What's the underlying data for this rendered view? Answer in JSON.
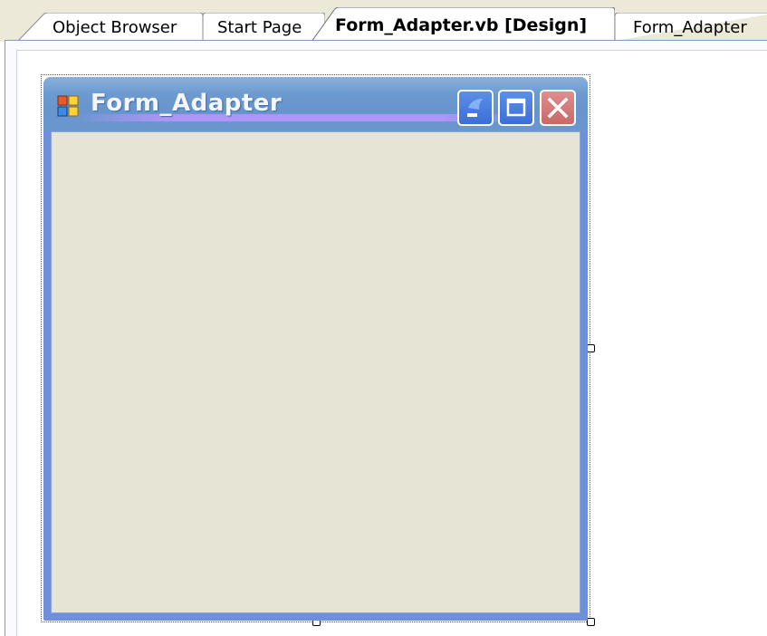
{
  "tabs": [
    {
      "label": "Object Browser",
      "active": false
    },
    {
      "label": "Start Page",
      "active": false
    },
    {
      "label": "Form_Adapter.vb [Design]",
      "active": true
    },
    {
      "label": "Form_Adapter",
      "active": false
    }
  ],
  "form": {
    "title": "Form_Adapter",
    "icon": "form-icon",
    "caption_buttons": [
      "minimize-icon",
      "maximize-icon",
      "close-icon"
    ]
  },
  "colors": {
    "titlebar": "#6d9bd0",
    "client_area": "#e6e5d5",
    "close_button": "#c96a6a",
    "tabstrip": "#ece9d8"
  }
}
